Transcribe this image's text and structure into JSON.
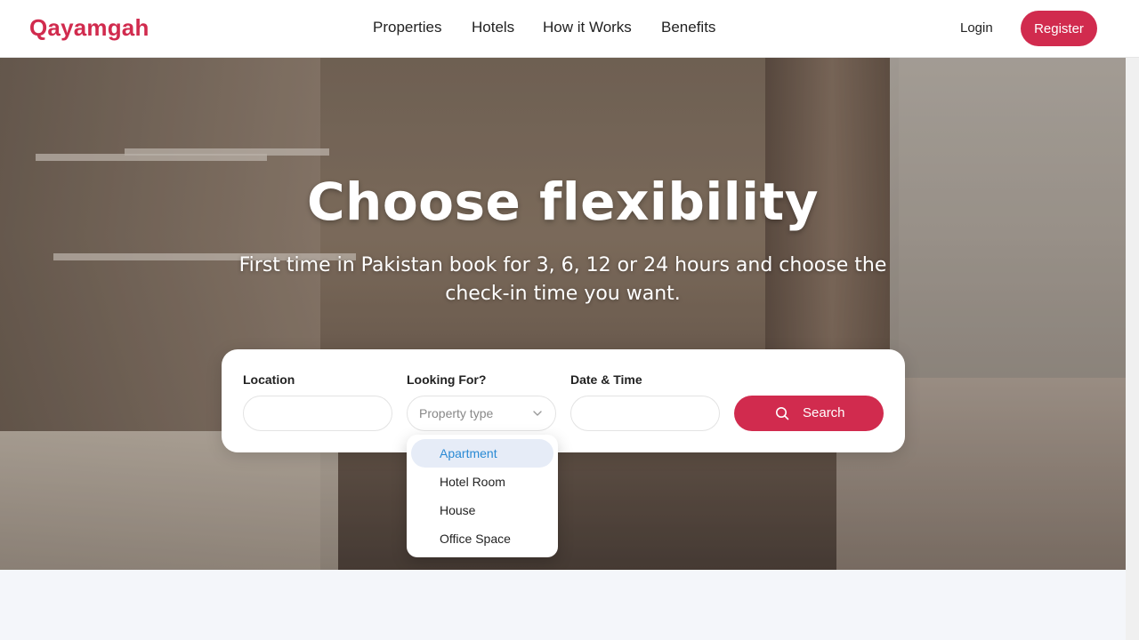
{
  "brand": {
    "name": "Qayamgah",
    "color": "#d12b4e"
  },
  "nav": {
    "items": [
      "Properties",
      "Hotels",
      "How it Works",
      "Benefits"
    ]
  },
  "auth": {
    "login": "Login",
    "register": "Register"
  },
  "hero": {
    "title": "Choose flexibility",
    "subtitle": "First time in Pakistan book for 3, 6, 12 or 24 hours and choose the check-in time you want."
  },
  "search": {
    "location_label": "Location",
    "location_value": "",
    "looking_for_label": "Looking For?",
    "property_type_placeholder": "Property type",
    "datetime_label": "Date & Time",
    "datetime_value": "",
    "button_label": "Search",
    "search_icon": "search-icon",
    "chevron_icon": "chevron-down-icon"
  },
  "dropdown": {
    "options": [
      "Apartment",
      "Hotel Room",
      "House",
      "Office Space"
    ],
    "highlighted": "Apartment"
  }
}
